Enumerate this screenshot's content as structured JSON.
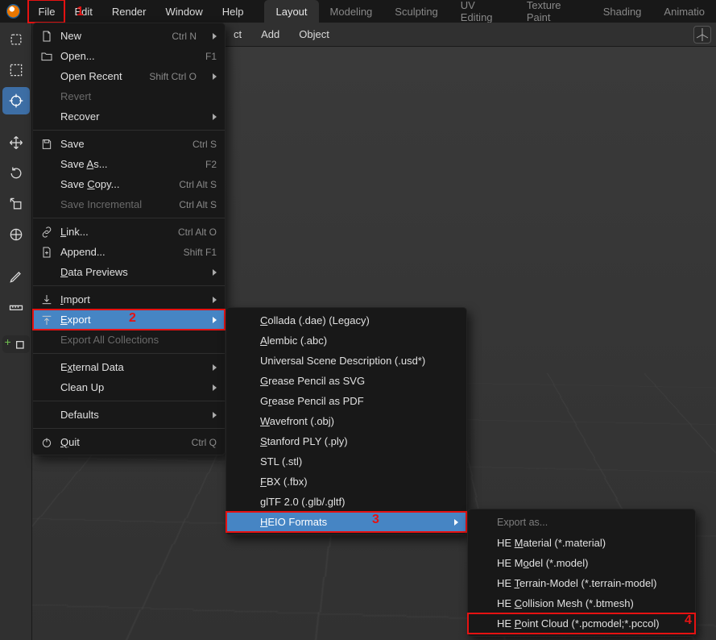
{
  "topmenu": {
    "file": "File",
    "edit": "Edit",
    "render": "Render",
    "window": "Window",
    "help": "Help"
  },
  "tabs": {
    "layout": "Layout",
    "modeling": "Modeling",
    "sculpting": "Sculpting",
    "uv_editing": "UV Editing",
    "texture_paint": "Texture Paint",
    "shading": "Shading",
    "animation": "Animatio"
  },
  "secondbar": {
    "ct": "ct",
    "add": "Add",
    "object": "Object"
  },
  "annotations": {
    "n1": "1",
    "n2": "2",
    "n3": "3",
    "n4": "4"
  },
  "file_menu": {
    "new": {
      "label": "New",
      "sc": "Ctrl N",
      "arrow": true
    },
    "open": {
      "label": "Open...",
      "sc": "F1"
    },
    "open_recent": {
      "label": "Open Recent",
      "sc": "Shift Ctrl O",
      "arrow": true
    },
    "revert": {
      "label": "Revert"
    },
    "recover": {
      "label": "Recover",
      "arrow": true
    },
    "save": {
      "label": "Save",
      "sc": "Ctrl S"
    },
    "save_as": {
      "pre": "Save ",
      "u": "A",
      "post": "s...",
      "sc": "F2"
    },
    "save_copy": {
      "pre": "Save ",
      "u": "C",
      "post": "opy...",
      "sc": "Ctrl Alt S"
    },
    "save_incremental": {
      "label": "Save Incremental",
      "sc": "Ctrl Alt S"
    },
    "link": {
      "pre": "",
      "u": "L",
      "post": "ink...",
      "sc": "Ctrl Alt O"
    },
    "append": {
      "label": "Append...",
      "sc": "Shift F1"
    },
    "data_previews": {
      "pre": "",
      "u": "D",
      "post": "ata Previews",
      "arrow": true
    },
    "import": {
      "pre": "",
      "u": "I",
      "post": "mport",
      "arrow": true
    },
    "export": {
      "pre": "",
      "u": "E",
      "post": "xport",
      "arrow": true
    },
    "export_all": {
      "label": "Export All Collections"
    },
    "external_data": {
      "pre": "E",
      "u": "x",
      "post": "ternal Data",
      "arrow": true
    },
    "clean_up": {
      "label": "Clean Up",
      "arrow": true
    },
    "defaults": {
      "label": "Defaults",
      "arrow": true
    },
    "quit": {
      "pre": "",
      "u": "Q",
      "post": "uit",
      "sc": "Ctrl Q"
    }
  },
  "export_menu": {
    "collada": {
      "pre": "",
      "u": "C",
      "post": "ollada (.dae) (Legacy)"
    },
    "alembic": {
      "pre": "",
      "u": "A",
      "post": "lembic (.abc)"
    },
    "usd": {
      "label": "Universal Scene Description (.usd*)"
    },
    "gp_svg": {
      "pre": "",
      "u": "G",
      "post": "rease Pencil as SVG"
    },
    "gp_pdf": {
      "pre": "G",
      "u": "r",
      "post": "ease Pencil as PDF"
    },
    "wavefront": {
      "pre": "",
      "u": "W",
      "post": "avefront (.obj)"
    },
    "stanford": {
      "pre": "",
      "u": "S",
      "post": "tanford PLY (.ply)"
    },
    "stl": {
      "label": "STL (.stl)"
    },
    "fbx": {
      "pre": "",
      "u": "F",
      "post": "BX (.fbx)"
    },
    "gltf": {
      "label": "glTF 2.0 (.glb/.gltf)"
    },
    "heio": {
      "pre": "",
      "u": "H",
      "post": "EIO Formats",
      "arrow": true
    }
  },
  "heio_menu": {
    "header": "Export as...",
    "material": {
      "pre": "HE ",
      "u": "M",
      "post": "aterial (*.material)"
    },
    "model": {
      "pre": "HE M",
      "u": "o",
      "post": "del (*.model)"
    },
    "terrain": {
      "pre": "HE ",
      "u": "T",
      "post": "errain-Model (*.terrain-model)"
    },
    "collision": {
      "pre": "HE ",
      "u": "C",
      "post": "ollision Mesh (*.btmesh)"
    },
    "pointcloud": {
      "pre": "HE ",
      "u": "P",
      "post": "oint Cloud (*.pcmodel;*.pccol)"
    }
  }
}
